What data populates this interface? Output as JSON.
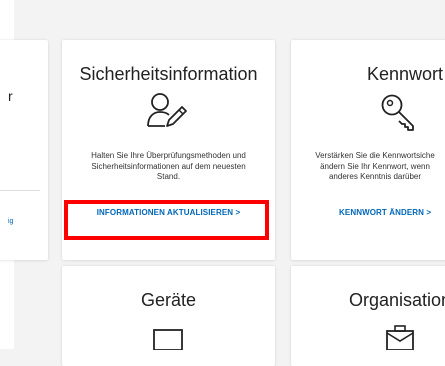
{
  "left_panel": {
    "partial_title": "r",
    "partial_link": "ig"
  },
  "cards": {
    "security_info": {
      "title": "Sicherheitsinformation",
      "description": "Halten Sie Ihre Überprüfungsmethoden und\nSicherheitsinformationen auf dem neuesten\nStand.",
      "link": "INFORMATIONEN AKTUALISIEREN  >",
      "icon": "person-edit-icon"
    },
    "password": {
      "title": "Kennwort",
      "description": "Verstärken Sie die Kennwortsiche\nändern Sie Ihr Kennwort, wenn\nanderes Kenntnis darüber",
      "link": "KENNWORT ÄNDERN  >",
      "icon": "key-icon"
    },
    "devices": {
      "title": "Geräte",
      "icon": "laptop-icon"
    },
    "organizations": {
      "title": "Organisatione",
      "icon": "briefcase-icon"
    }
  },
  "colors": {
    "link": "#0067b8",
    "highlight": "#ff0000",
    "background": "#f3f3f3",
    "card": "#ffffff"
  }
}
